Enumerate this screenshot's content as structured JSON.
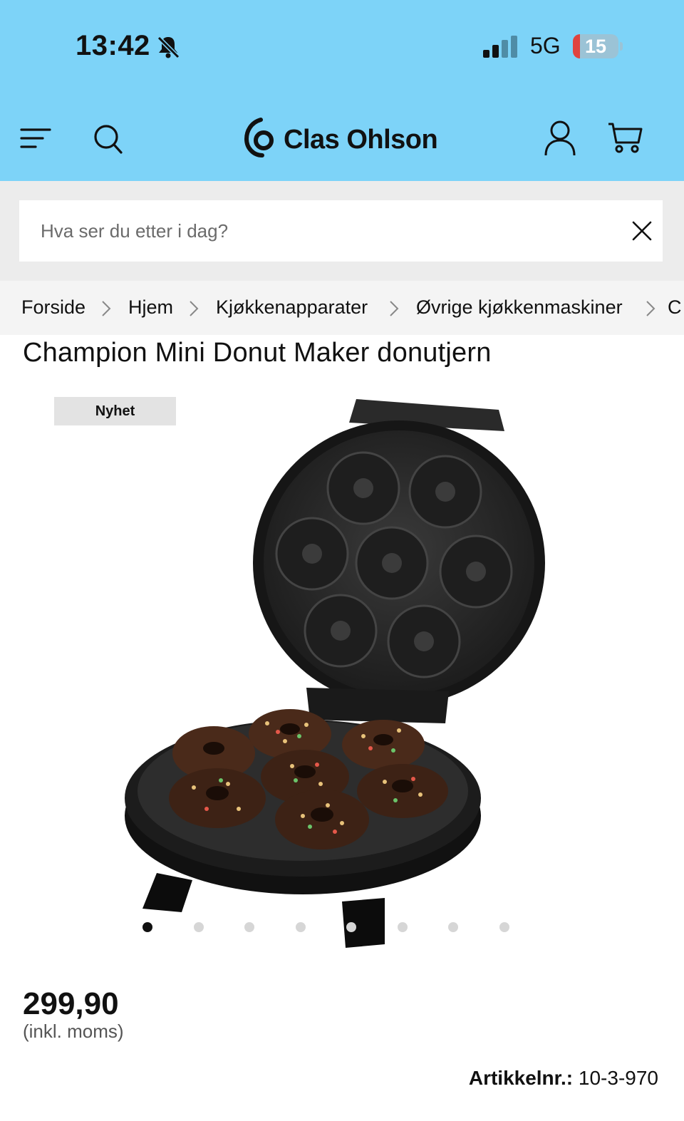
{
  "status_bar": {
    "time": "13:42",
    "network": "5G",
    "battery": "15",
    "battery_level_percent": 15
  },
  "header": {
    "brand": "Clas Ohlson",
    "brand_color": "#7dd3f8"
  },
  "search": {
    "placeholder": "Hva ser du etter i dag?",
    "value": ""
  },
  "breadcrumb": [
    {
      "label": "Forside"
    },
    {
      "label": "Hjem"
    },
    {
      "label": "Kjøkkenapparater"
    },
    {
      "label": "Øvrige kjøkkenmaskiner"
    },
    {
      "label": "C"
    }
  ],
  "product": {
    "title": "Champion Mini Donut Maker donutjern",
    "badge": "Nyhet",
    "image_count": 8,
    "active_image_index": 0,
    "price": "299,90",
    "price_note": "(inkl. moms)",
    "article_label": "Artikkelnr.:",
    "article_number": "10-3-970"
  }
}
